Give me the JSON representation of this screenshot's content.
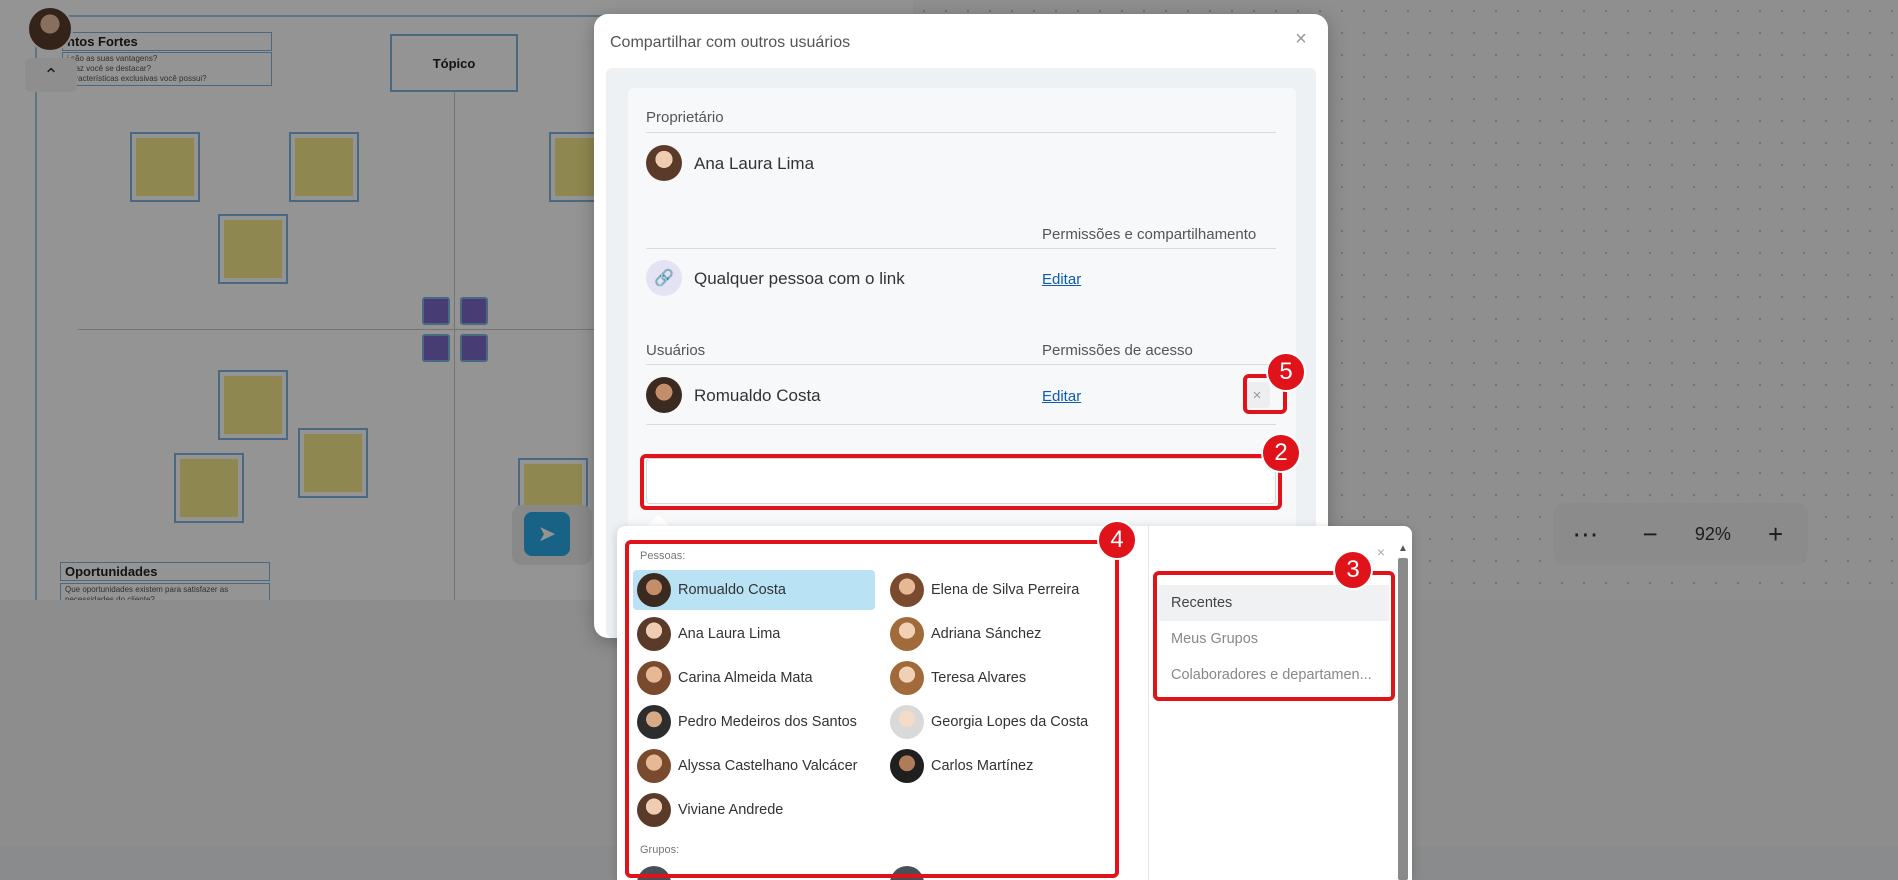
{
  "board": {
    "quadrant_top_left_title": "ntos Fortes",
    "quadrant_top_left_sub": "i são as suas vantagens?\nc faz você se destacar?\ncaracterísticas exclusivas você possui?",
    "topic_label": "Tópico",
    "quadrant_bottom_left_title": "Oportunidades",
    "quadrant_bottom_left_sub": "Que oportunidades existem para satisfazer as\nnecessidades do cliente?",
    "zoom": {
      "level": "92%",
      "more_icon": "more-horizontal-icon",
      "minus_icon": "minus-icon",
      "plus_icon": "plus-icon"
    },
    "select_tool_icon": "cursor-arrow-icon"
  },
  "dialog": {
    "title": "Compartilhar com outros usuários",
    "owner_label": "Proprietário",
    "owner_name": "Ana Laura Lima",
    "sharing_header": "Permissões e compartilhamento",
    "link_access_text": "Qualquer pessoa com o link",
    "link_edit_label": "Editar",
    "users_label": "Usuários",
    "access_header": "Permissões de acesso",
    "user_name": "Romualdo Costa",
    "user_edit_label": "Editar",
    "search_value": ""
  },
  "dropdown": {
    "people_heading": "Pessoas:",
    "groups_heading": "Grupos:",
    "people": [
      {
        "name": "Romualdo Costa",
        "selected": true
      },
      {
        "name": "Elena de Silva Perreira"
      },
      {
        "name": "Ana Laura Lima"
      },
      {
        "name": "Adriana Sánchez"
      },
      {
        "name": "Carina Almeida Mata"
      },
      {
        "name": "Teresa Alvares"
      },
      {
        "name": "Pedro Medeiros dos Santos"
      },
      {
        "name": "Georgia Lopes da Costa"
      },
      {
        "name": "Alyssa Castelhano Valcácer"
      },
      {
        "name": "Carlos Martínez"
      },
      {
        "name": "Viviane Andrede"
      }
    ],
    "categories": [
      {
        "label": "Recentes",
        "active": true
      },
      {
        "label": "Meus Grupos"
      },
      {
        "label": "Colaboradores e departamen..."
      }
    ]
  },
  "annotations": {
    "badge_2": "2",
    "badge_3": "3",
    "badge_4": "4",
    "badge_5": "5",
    "color": "#e0121a"
  }
}
